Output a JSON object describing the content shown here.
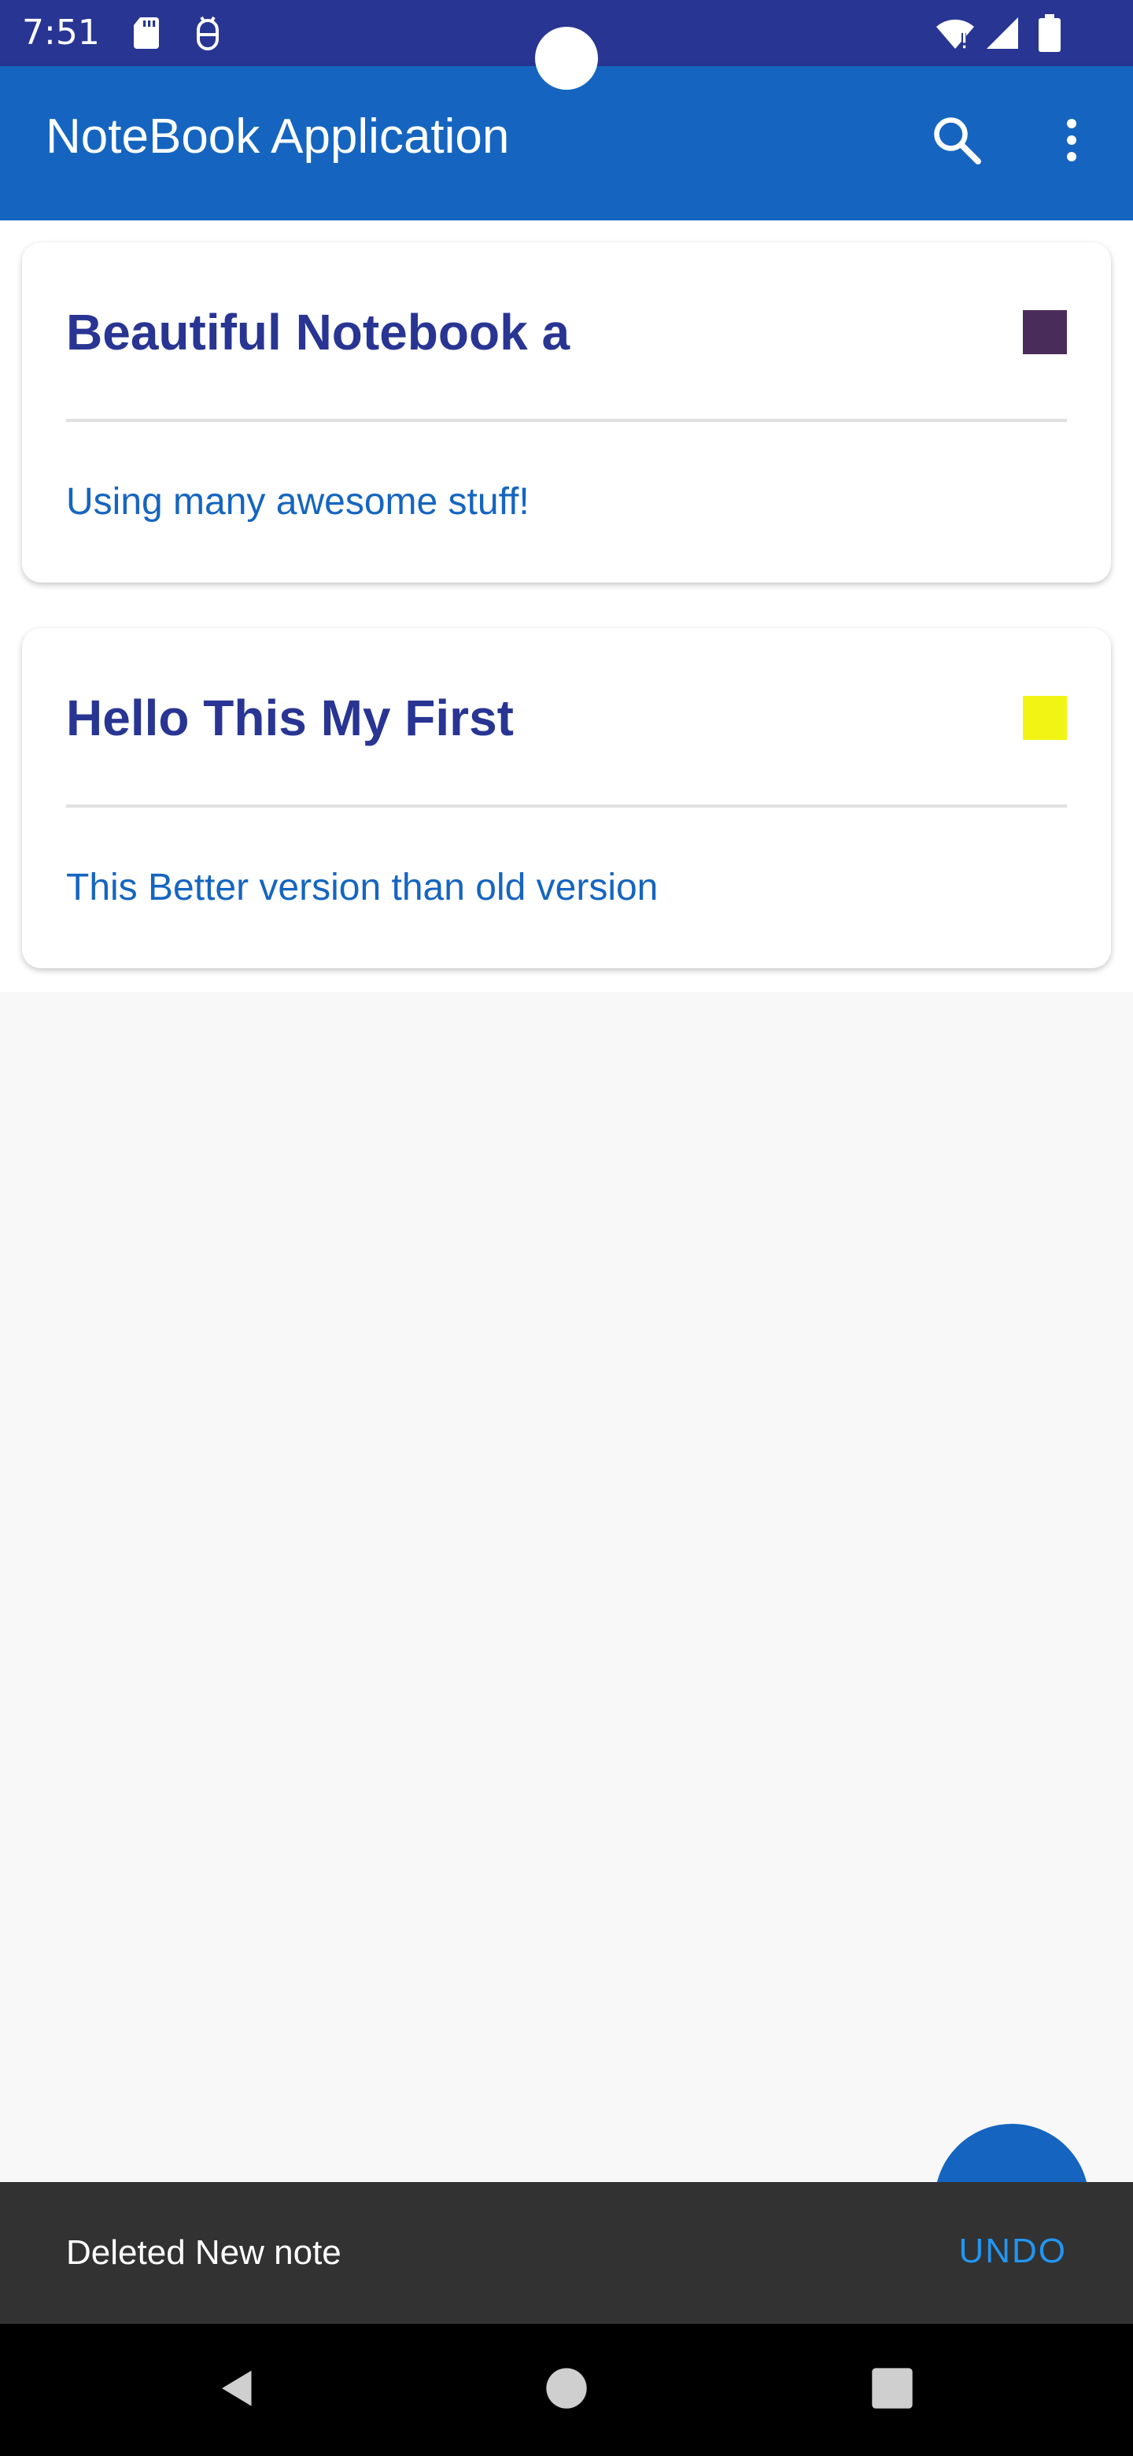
{
  "status_bar": {
    "time": "7:51",
    "left_icons": [
      "sd-card-icon",
      "android-debug-icon"
    ],
    "right_icons": [
      "wifi-alert-icon",
      "cell-signal-icon",
      "battery-icon"
    ],
    "background": "#283593"
  },
  "app_bar": {
    "title": "NoteBook Application",
    "actions": [
      "search-icon",
      "more-vert-icon"
    ],
    "background": "#1565c0"
  },
  "notes": [
    {
      "title": "Beautiful Notebook a",
      "description": "Using many awesome stuff!",
      "color": "#4a2c5a"
    },
    {
      "title": "Hello This My First",
      "description": "This Better version than old version",
      "color": "#f2f514"
    }
  ],
  "fab": {
    "icon": "add-icon",
    "color": "#1565c0"
  },
  "snackbar": {
    "message": "Deleted New note",
    "action": "UNDO",
    "action_color": "#2196f3"
  },
  "nav_bar": {
    "buttons": [
      "back-icon",
      "home-icon",
      "recents-icon"
    ]
  }
}
